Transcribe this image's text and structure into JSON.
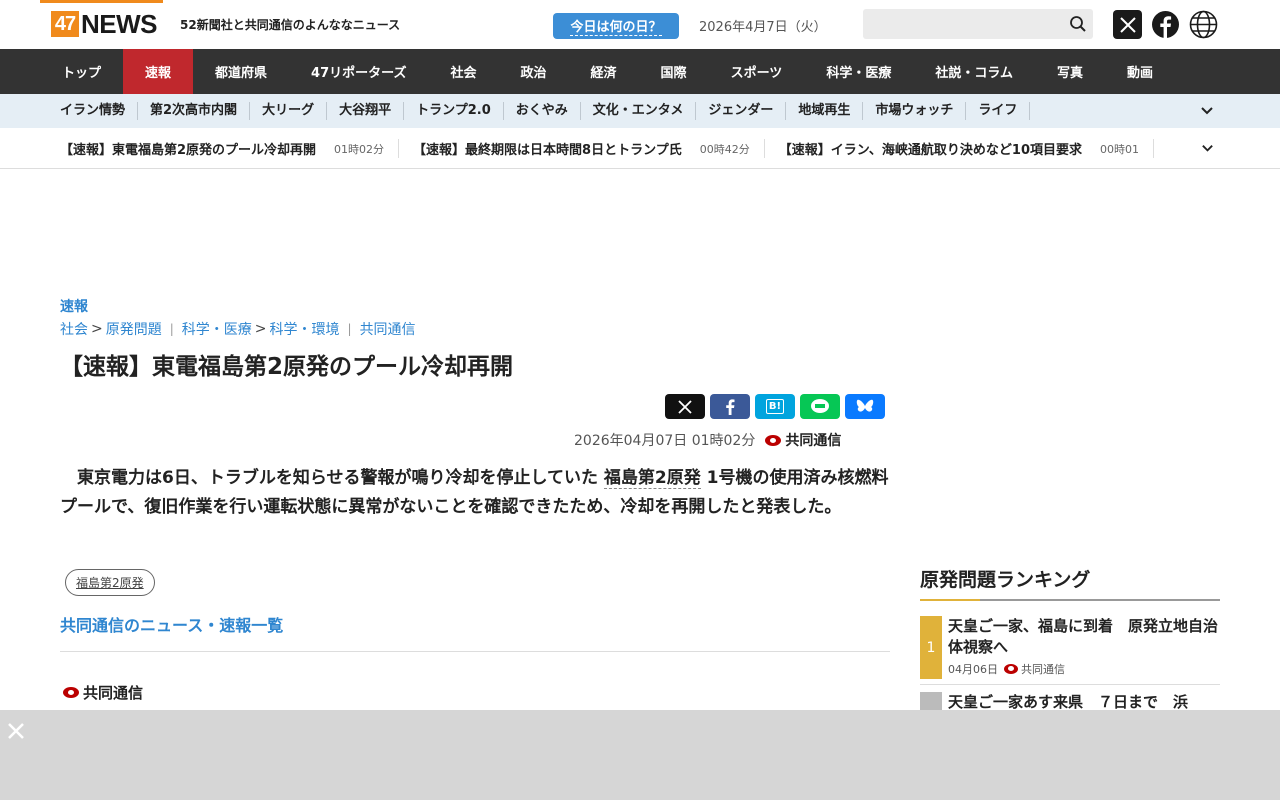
{
  "header": {
    "logo_47": "47",
    "logo_news": "NEWS",
    "tagline": "52新聞社と共同通信のよんななニュース",
    "today_button": "今日は何の日？",
    "date": "2026年4月7日（火）",
    "search_placeholder": ""
  },
  "mainnav": {
    "items": [
      "トップ",
      "速報",
      "都道府県",
      "47リポーターズ",
      "社会",
      "政治",
      "経済",
      "国際",
      "スポーツ",
      "科学・医療",
      "社説・コラム",
      "写真",
      "動画"
    ],
    "active": "速報"
  },
  "subnav": {
    "items": [
      "イラン情勢",
      "第2次高市内閣",
      "大リーグ",
      "大谷翔平",
      "トランプ2.0",
      "おくやみ",
      "文化・エンタメ",
      "ジェンダー",
      "地域再生",
      "市場ウォッチ",
      "ライフ"
    ]
  },
  "ticker": {
    "items": [
      {
        "title": "【速報】東電福島第2原発のプール冷却再開",
        "time": "01時02分"
      },
      {
        "title": "【速報】最終期限は日本時間8日とトランプ氏",
        "time": "00時42分"
      },
      {
        "title": "【速報】イラン、海峡通航取り決めなど10項目要求",
        "time": "00時01"
      }
    ]
  },
  "article": {
    "category": "速報",
    "breadcrumb": {
      "c1": "社会",
      "c2": "原発問題",
      "c3": "科学・医療",
      "c4": "科学・環境",
      "c5": "共同通信"
    },
    "headline": "【速報】東電福島第2原発のプール冷却再開",
    "share": {
      "hatena": "B!"
    },
    "published": "2026年04月07日 01時02分",
    "source": "共同通信",
    "body_pre": "　東京電力は6日、トラブルを知らせる警報が鳴り冷却を停止していた ",
    "body_kw": "福島第2原発",
    "body_post": " 1号機の使用済み核燃料プールで、復旧作業を行い運転状態に異常がないことを確認できたため、冷却を再開したと発表した。",
    "tag": "福島第2原発",
    "list_link": "共同通信のニュース・速報一覧",
    "bottom_source": "共同通信"
  },
  "ranking": {
    "title": "原発問題ランキング",
    "items": [
      {
        "rank": "1",
        "title": "天皇ご一家、福島に到着　原発立地自治体視察へ",
        "date": "04月06日",
        "source": "共同通信"
      },
      {
        "rank": "",
        "title": "天皇ご一家あす来県　７日まで　浜"
      }
    ]
  },
  "colors": {
    "brand_orange": "#f08a1c",
    "nav_dark": "#333333",
    "nav_active": "#c0282d",
    "link_blue": "#2f86d0",
    "rank_gold": "#e0b23a"
  }
}
